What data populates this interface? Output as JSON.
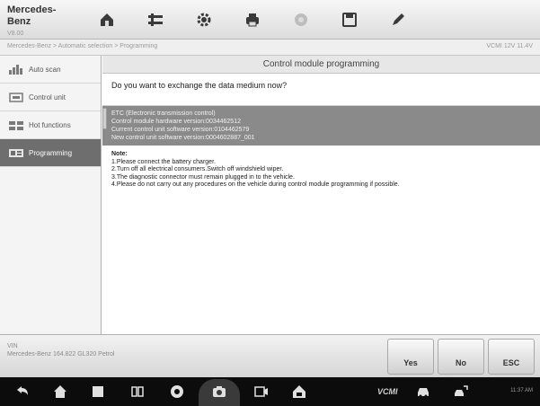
{
  "app": {
    "brand": "Mercedes-Benz",
    "brand_sub": "V8.00"
  },
  "toolbar": {
    "icons": [
      "home-icon",
      "vehicle-swap-icon",
      "settings-icon",
      "print-icon",
      "help-icon",
      "save-icon",
      "edit-icon"
    ]
  },
  "breadcrumb": "Mercedes-Benz > Automatic selection > Programming",
  "status": "VCMI 12V 11.4V",
  "sidebar": {
    "items": [
      {
        "label": "Auto scan",
        "icon": "auto-scan-icon"
      },
      {
        "label": "Control unit",
        "icon": "control-unit-icon"
      },
      {
        "label": "Hot functions",
        "icon": "hot-functions-icon"
      },
      {
        "label": "Programming",
        "icon": "programming-icon",
        "active": true
      }
    ]
  },
  "main": {
    "title": "Control module programming",
    "question": "Do you want to exchange the data medium now?",
    "info_lines": [
      "ETC (Electronic transmission control)",
      "Control module hardware version:0034462512",
      "Current control unit software version:0104462579",
      "New control unit software version:0004602887_001"
    ],
    "notes_title": "Note:",
    "notes": [
      "1.Please connect the battery charger.",
      "2.Turn off all electrical consumers.Switch off windshield wiper.",
      "3.The diagnostic connector must remain plugged in to the vehicle.",
      "4.Please do not carry out any procedures on the vehicle during control module programming if possible."
    ]
  },
  "bottom": {
    "vin_label": "VIN",
    "vin_value": "Mercedes-Benz 164.822 GL320 Petrol",
    "buttons": {
      "yes": "Yes",
      "no": "No",
      "esc": "ESC"
    }
  },
  "navbar": {
    "icons": [
      "back-icon",
      "home-icon",
      "recent-apps-icon",
      "window-icon",
      "browser-icon",
      "camera-icon",
      "screen-record-icon",
      "car-home-icon",
      "car-icon",
      "car-network-icon"
    ],
    "vcmi_label": "VCMI",
    "tray": "11:37 AM"
  },
  "colors": {
    "active_item": "#6e6e6e",
    "info_band": "#8a8a8a",
    "nav_bg": "#0c0c0c"
  }
}
